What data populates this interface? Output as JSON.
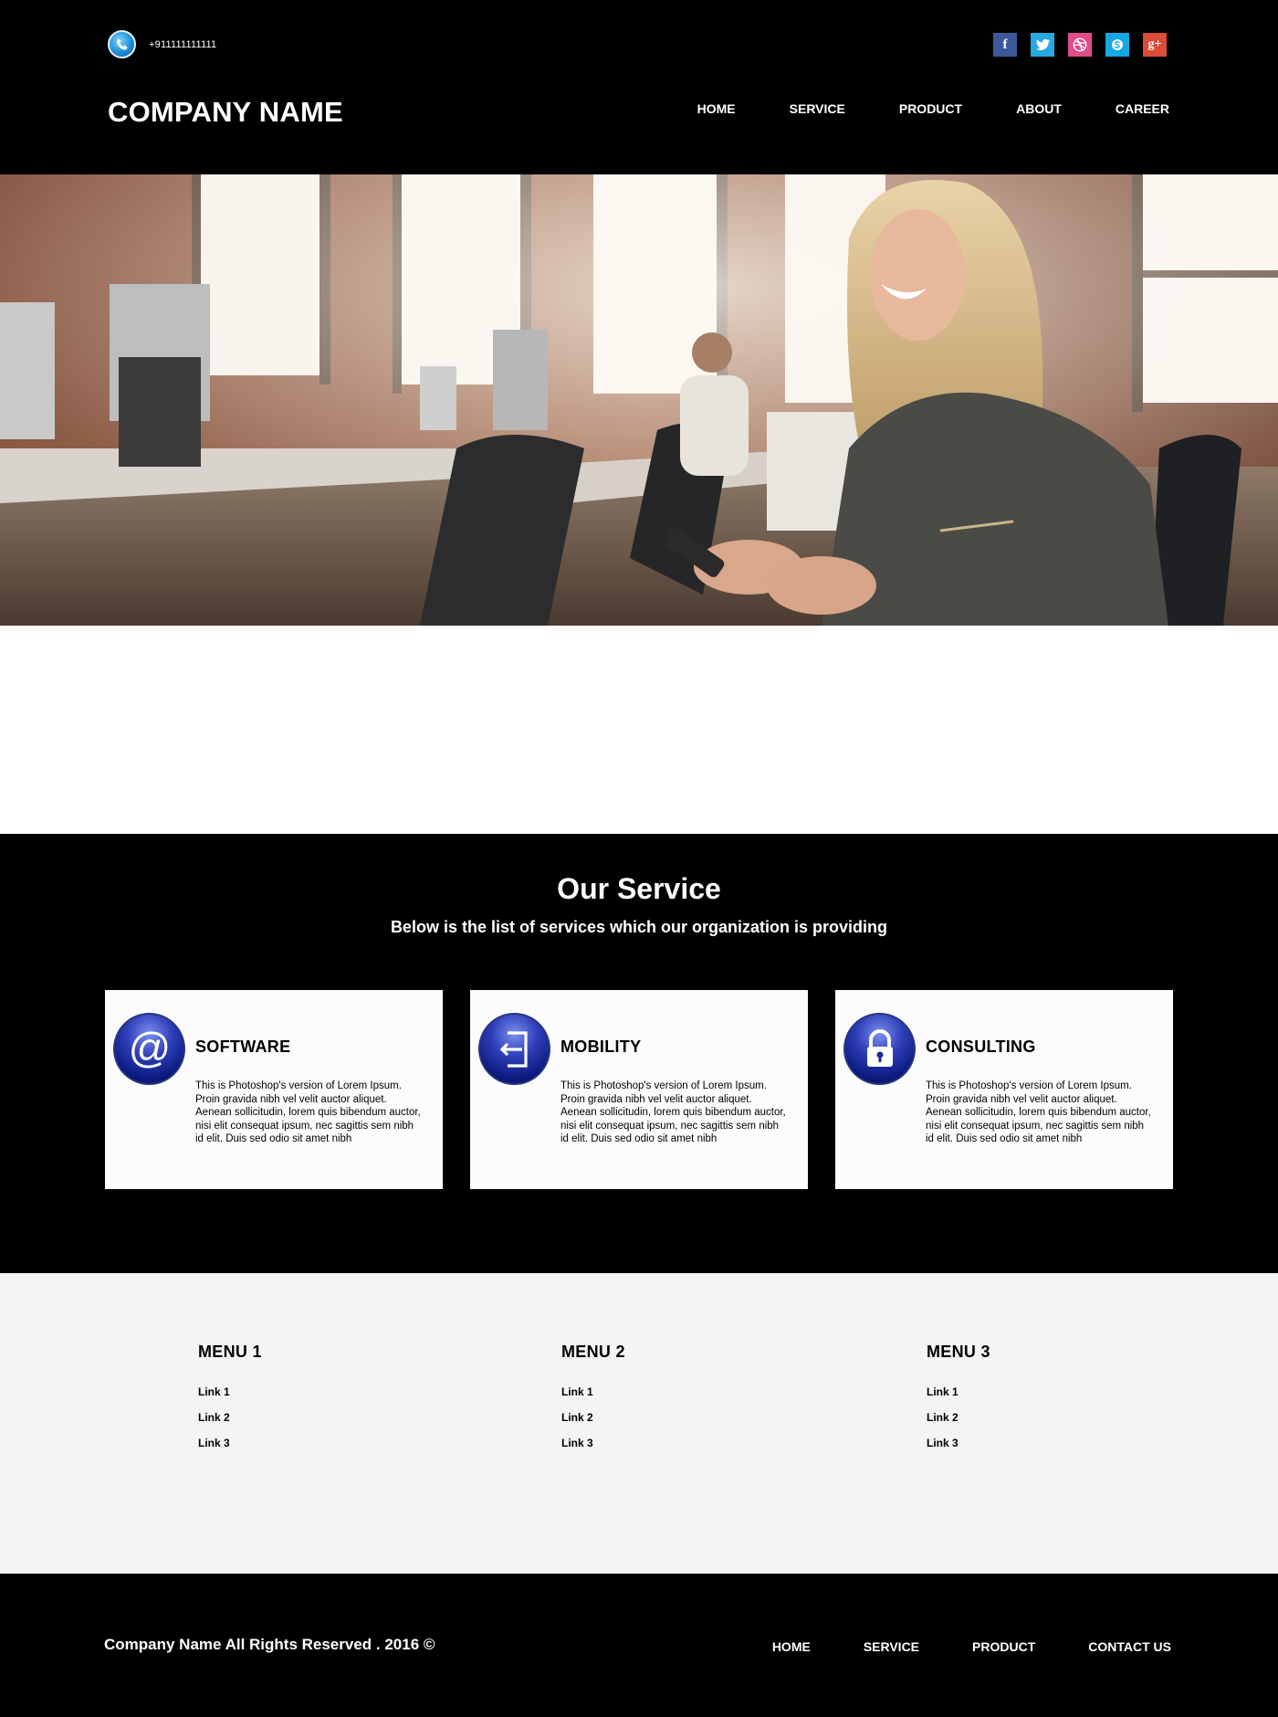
{
  "header": {
    "phone_icon": "phone-icon",
    "phone": "+911111111111",
    "company_name": "COMPANY NAME",
    "social": [
      {
        "name": "facebook",
        "glyph": "f",
        "color": "#3b5998"
      },
      {
        "name": "twitter",
        "glyph": "",
        "color": "#29a9e1"
      },
      {
        "name": "dribbble",
        "glyph": "",
        "color": "#e24c89"
      },
      {
        "name": "skype",
        "glyph": "",
        "color": "#13a8e4"
      },
      {
        "name": "google-plus",
        "glyph": "g+",
        "color": "#dd4b39"
      }
    ],
    "nav": [
      "HOME",
      "SERVICE",
      "PRODUCT",
      "ABOUT",
      "CAREER"
    ]
  },
  "hero": {
    "image": "office-woman-smiling-with-phone"
  },
  "services": {
    "title": "Our Service",
    "subtitle": "Below is the list of services which our organization is providing",
    "cards": [
      {
        "icon": "at-sign-icon",
        "title": "SOFTWARE",
        "text": "This is Photoshop's version  of Lorem Ipsum. Proin gravida nibh vel velit auctor aliquet. Aenean sollicitudin, lorem quis bibendum auctor, nisi elit consequat ipsum, nec sagittis sem nibh id elit. Duis sed odio sit amet nibh"
      },
      {
        "icon": "sign-in-icon",
        "title": "MOBILITY",
        "text": "This is Photoshop's version  of Lorem Ipsum. Proin gravida nibh vel velit auctor aliquet. Aenean sollicitudin, lorem quis bibendum auctor, nisi elit consequat ipsum, nec sagittis sem nibh id elit. Duis sed odio sit amet nibh"
      },
      {
        "icon": "padlock-icon",
        "title": "CONSULTING",
        "text": "This is Photoshop's version  of Lorem Ipsum. Proin gravida nibh vel velit auctor aliquet. Aenean sollicitudin, lorem quis bibendum auctor, nisi elit consequat ipsum, nec sagittis sem nibh id elit. Duis sed odio sit amet nibh"
      }
    ]
  },
  "menus": [
    {
      "title": "MENU 1",
      "links": [
        "Link 1",
        "Link 2",
        "Link 3"
      ]
    },
    {
      "title": "MENU 2",
      "links": [
        "Link 1",
        "Link 2",
        "Link 3"
      ]
    },
    {
      "title": "MENU 3",
      "links": [
        "Link 1",
        "Link 2",
        "Link 3"
      ]
    }
  ],
  "footer": {
    "copyright": "Company Name All Rights Reserved . 2016 ©",
    "nav": [
      "HOME",
      "SERVICE",
      "PRODUCT",
      "CONTACT US"
    ]
  }
}
